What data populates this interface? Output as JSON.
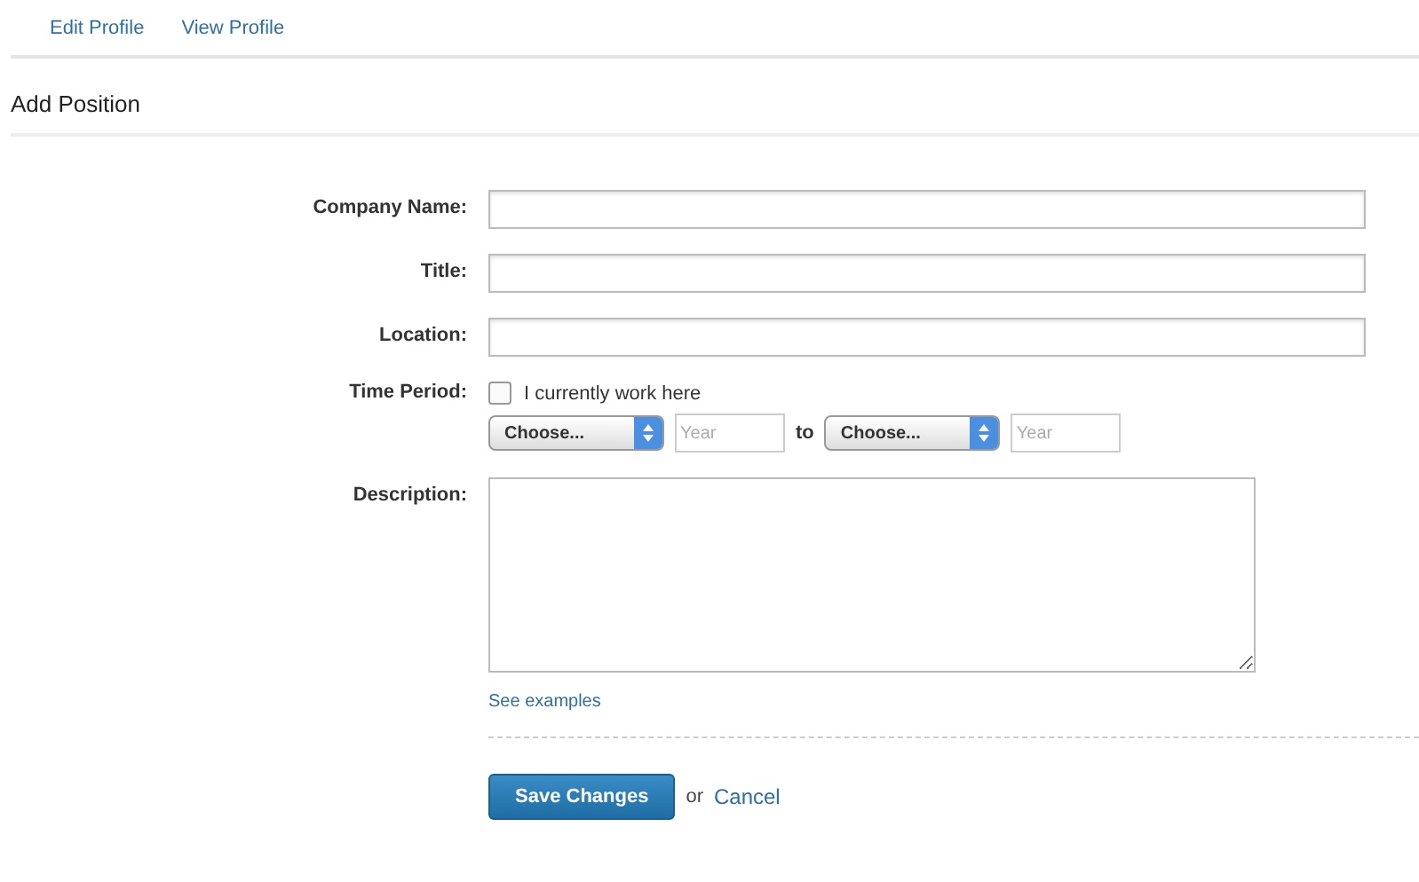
{
  "tabs": [
    {
      "label": "Edit Profile"
    },
    {
      "label": "View Profile"
    }
  ],
  "heading": "Add Position",
  "fields": [
    {
      "label": "Company Name:"
    },
    {
      "label": "Title:"
    },
    {
      "label": "Location:"
    }
  ],
  "time_period": {
    "label": "Time Period:",
    "checkbox": {
      "label": "I currently work here",
      "checked": false
    },
    "start_month": "Choose...",
    "start_year_placeholder": "Year",
    "to": "to",
    "end_month": "Choose...",
    "end_year_placeholder": "Year"
  },
  "description": {
    "label": "Description:",
    "link": "See examples"
  },
  "actions": {
    "save": "Save Changes",
    "or": "or",
    "cancel": "Cancel"
  }
}
